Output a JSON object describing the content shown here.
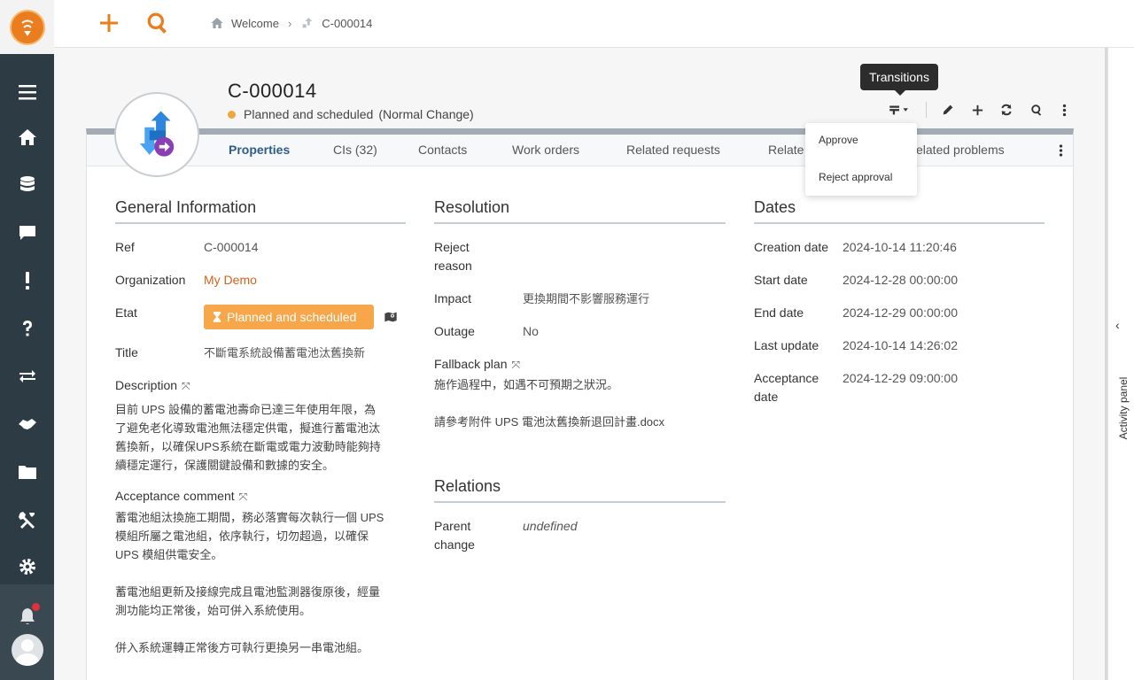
{
  "breadcrumb": {
    "home_label": "Welcome",
    "current_label": "C-000014"
  },
  "header": {
    "ref": "C-000014",
    "status": "Planned and scheduled",
    "type": "(Normal Change)"
  },
  "colors": {
    "accent": "#ea7d1e",
    "nav_bg": "#2d3b45",
    "status_dot": "#f0a63c",
    "badge": "#f7a64a",
    "link": "#d5611a"
  },
  "tooltip": "Transitions",
  "transitions_menu": [
    "Approve",
    "Reject approval"
  ],
  "tabs": [
    {
      "label": "Properties",
      "active": true
    },
    {
      "label": "CIs (32)"
    },
    {
      "label": "Contacts"
    },
    {
      "label": "Work orders"
    },
    {
      "label": "Related requests"
    },
    {
      "label": "Relate"
    },
    {
      "label": "elated problems"
    }
  ],
  "general": {
    "title": "General Information",
    "ref_label": "Ref",
    "ref_value": "C-000014",
    "org_label": "Organization",
    "org_value": "My Demo",
    "etat_label": "Etat",
    "etat_value": "Planned and scheduled",
    "title_label": "Title",
    "title_value": "不斷電系統設備蓄電池汰舊換新",
    "description_label": "Description",
    "description_lines": [
      "目前 UPS 設備的蓄電池壽命已達三年使用年限，為",
      "了避免老化導致電池無法穩定供電，擬進行蓄電池汰",
      "舊換新，以確保UPS系統在斷電或電力波動時能夠持",
      "續穩定運行，保護關鍵設備和數據的安全。"
    ],
    "acceptance_label": "Acceptance comment",
    "acceptance_lines": [
      "蓄電池組汰換施工期間，務必落實每次執行一個 UPS",
      "模組所屬之電池組，依序執行，切勿超過，以確保",
      "UPS 模組供電安全。",
      "",
      "蓄電池組更新及接線完成且電池監測器復原後，經量",
      "測功能均正常後，始可併入系統使用。",
      "",
      "併入系統運轉正常後方可執行更換另一串電池組。"
    ]
  },
  "resolution": {
    "title": "Resolution",
    "reject_label_1": "Reject",
    "reject_label_2": "reason",
    "impact_label": "Impact",
    "impact_value": "更換期間不影響服務運行",
    "outage_label": "Outage",
    "outage_value": "No",
    "fallback_label": "Fallback plan",
    "fallback_lines": [
      "施作過程中，如遇不可預期之狀況。",
      "",
      "請參考附件 UPS 電池汰舊換新退回計畫.docx"
    ]
  },
  "relations": {
    "title": "Relations",
    "parent_label_1": "Parent",
    "parent_label_2": "change",
    "parent_value": "undefined"
  },
  "dates": {
    "title": "Dates",
    "creation_label": "Creation date",
    "creation_value": "2024-10-14 11:20:46",
    "start_label": "Start date",
    "start_value": "2024-12-28 00:00:00",
    "end_label": "End date",
    "end_value": "2024-12-29 00:00:00",
    "update_label": "Last update",
    "update_value": "2024-10-14 14:26:02",
    "acceptance_label_1": "Acceptance",
    "acceptance_label_2": "date",
    "acceptance_value": "2024-12-29 09:00:00"
  },
  "activity_panel": "Activity panel"
}
